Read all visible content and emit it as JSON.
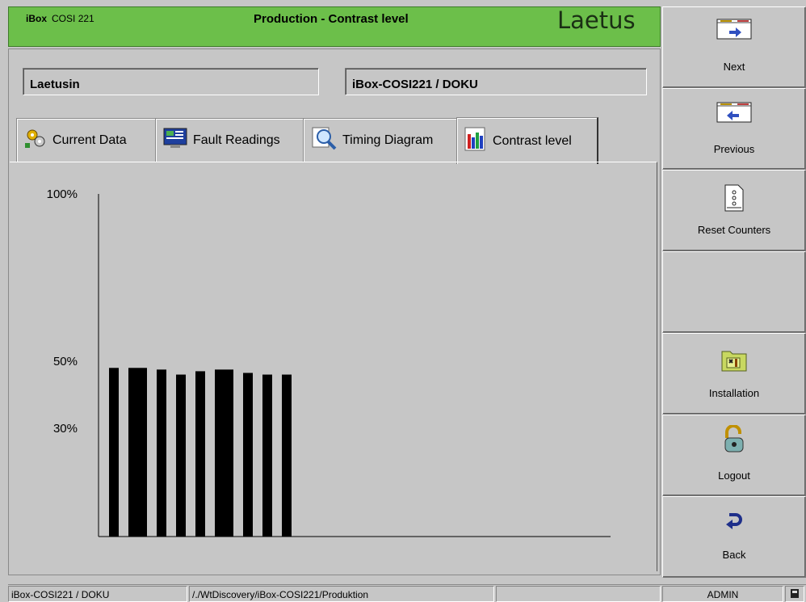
{
  "header": {
    "app_name": "iBox",
    "app_model": "COSI 221",
    "title": "Production - Contrast level",
    "brand": "Laetus",
    "bg_color": "#6cbf4a"
  },
  "fields": {
    "left_value": "Laetusin",
    "right_value": "iBox-COSI221 / DOKU"
  },
  "tabs": [
    {
      "label": "Current Data",
      "icon": "gears-icon"
    },
    {
      "label": "Fault Readings",
      "icon": "monitor-icon"
    },
    {
      "label": "Timing Diagram",
      "icon": "magnifier-icon"
    },
    {
      "label": "Contrast level",
      "icon": "bar-chart-icon",
      "active": true
    }
  ],
  "sidebar": {
    "buttons": [
      {
        "label": "Next",
        "icon": "arrow-right-icon"
      },
      {
        "label": "Previous",
        "icon": "arrow-left-icon"
      },
      {
        "label": "Reset Counters",
        "icon": "reset-document-icon"
      },
      {
        "label": "",
        "icon": ""
      },
      {
        "label": "Installation",
        "icon": "tools-folder-icon"
      },
      {
        "label": "Logout",
        "icon": "padlock-icon"
      },
      {
        "label": "Back",
        "icon": "back-arrow-icon"
      }
    ]
  },
  "chart_data": {
    "type": "bar",
    "title": "",
    "ylabel": "",
    "xlabel": "",
    "ytick_labels": [
      "100%",
      "50%",
      "30%"
    ],
    "yticks": [
      100,
      50,
      30
    ],
    "ylim": [
      0,
      100
    ],
    "grid": false,
    "bar_color": "#000000",
    "values": [
      48,
      48,
      47.5,
      46,
      47,
      47.5,
      46.5,
      46,
      46
    ]
  },
  "statusbar": {
    "device": "iBox-COSI221 / DOKU",
    "path": "/./WtDiscovery/iBox-COSI221/Produktion",
    "user": "ADMIN"
  }
}
